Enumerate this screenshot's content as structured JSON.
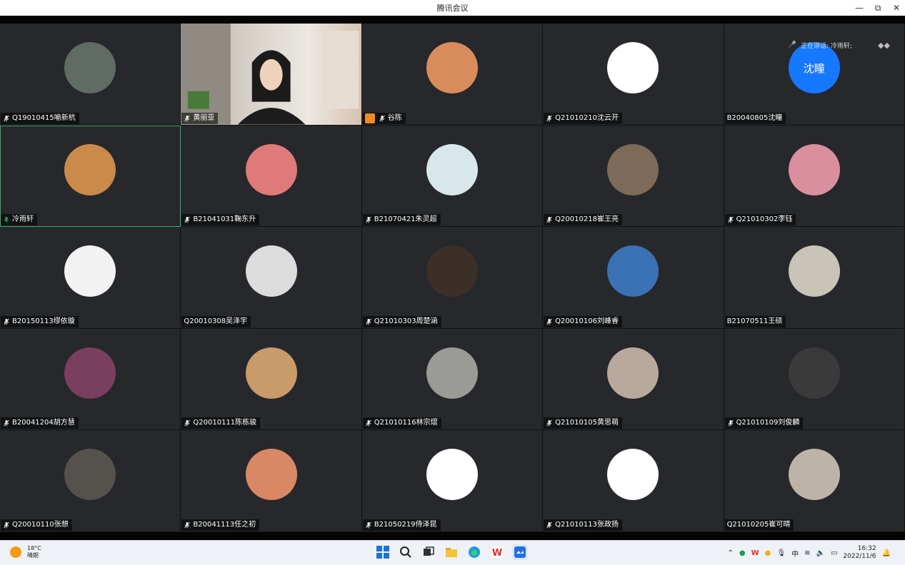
{
  "window": {
    "title": "腾讯会议",
    "minimize_label": "—",
    "restore_label": "⧉",
    "close_label": "✕"
  },
  "speaking_banner": {
    "text": "正在讲话: 冷雨轩;"
  },
  "participants": [
    {
      "name": "Q19010415喻新杭",
      "mic": true,
      "avatar_color": "#5f6b63"
    },
    {
      "name": "黄丽亚",
      "mic": true,
      "video": true
    },
    {
      "name": "谷陈",
      "mic": true,
      "host": true,
      "avatar_color": "#d98c5b"
    },
    {
      "name": "Q21010210沈云开",
      "mic": true,
      "avatar_color": "#ffffff"
    },
    {
      "name": "B20040805沈瞳",
      "mic": false,
      "avatar_text": "沈瞳",
      "avatar_color": "#1677ff"
    },
    {
      "name": "冷雨轩",
      "mic": true,
      "speaking": true,
      "avatar_color": "#c98a4a"
    },
    {
      "name": "B21041031鞠东升",
      "mic": true,
      "avatar_color": "#e07a7a"
    },
    {
      "name": "B21070421朱灵超",
      "mic": true,
      "avatar_color": "#d7e7ea"
    },
    {
      "name": "Q20010218崔王亮",
      "mic": true,
      "avatar_color": "#7d6a58"
    },
    {
      "name": "Q21010302李钰",
      "mic": true,
      "avatar_color": "#d98f9e"
    },
    {
      "name": "B20150113缪依璇",
      "mic": true,
      "avatar_color": "#f2f2f2"
    },
    {
      "name": "Q20010308吴泽宇",
      "mic": false,
      "avatar_color": "#dcdcdc"
    },
    {
      "name": "Q21010303周楚涵",
      "mic": true,
      "avatar_color": "#3b2f28"
    },
    {
      "name": "Q20010106刘峰睿",
      "mic": true,
      "avatar_color": "#3a72b5"
    },
    {
      "name": "B21070511王硕",
      "mic": false,
      "avatar_color": "#c9c4b8"
    },
    {
      "name": "B20041204胡方慧",
      "mic": true,
      "avatar_color": "#7a3f5e"
    },
    {
      "name": "Q20010111陈栋骏",
      "mic": true,
      "avatar_color": "#c99a6a"
    },
    {
      "name": "Q21010116林宗熠",
      "mic": true,
      "avatar_color": "#9a9a96"
    },
    {
      "name": "Q21010105黄思萌",
      "mic": true,
      "avatar_color": "#b9a89c"
    },
    {
      "name": "Q21010109刘俊麟",
      "mic": true,
      "avatar_color": "#3a3a3a"
    },
    {
      "name": "Q20010110张想",
      "mic": true,
      "avatar_color": "#55514c"
    },
    {
      "name": "B20041113任之初",
      "mic": true,
      "avatar_color": "#d98866"
    },
    {
      "name": "B21050219侍泽昆",
      "mic": true,
      "avatar_color": "#ffffff"
    },
    {
      "name": "Q21010113张政扬",
      "mic": true,
      "avatar_color": "#ffffff"
    },
    {
      "name": "Q21010205崔可晴",
      "mic": false,
      "avatar_color": "#bdb3a8"
    }
  ],
  "taskbar": {
    "weather_temp": "18°C",
    "weather_desc": "晴朗",
    "ime": "中",
    "time": "16:32",
    "date": "2022/11/6"
  },
  "colors": {
    "tile_bg": "#26282b",
    "active_border": "#2fb26a",
    "host_badge": "#f08a24"
  }
}
